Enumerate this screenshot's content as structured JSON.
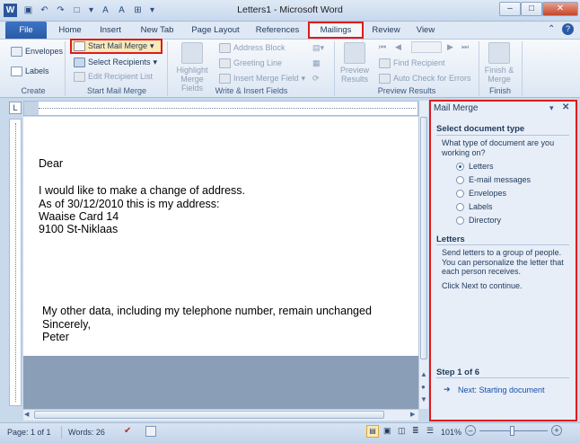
{
  "window": {
    "title": "Letters1 - Microsoft Word"
  },
  "tabs": [
    "File",
    "Home",
    "Insert",
    "New Tab",
    "Page Layout",
    "References",
    "Mailings",
    "Review",
    "View"
  ],
  "ribbon": {
    "create": {
      "label": "Create",
      "envelopes": "Envelopes",
      "labels": "Labels"
    },
    "start": {
      "label": "Start Mail Merge",
      "start_btn": "Start Mail Merge",
      "select_recipients": "Select Recipients",
      "edit_list": "Edit Recipient List"
    },
    "write": {
      "label": "Write & Insert Fields",
      "highlight_1": "Highlight",
      "highlight_2": "Merge Fields",
      "address_block": "Address Block",
      "greeting_line": "Greeting Line",
      "insert_merge_field": "Insert Merge Field"
    },
    "preview": {
      "label": "Preview Results",
      "preview_1": "Preview",
      "preview_2": "Results",
      "find_recipient": "Find Recipient",
      "auto_check": "Auto Check for Errors"
    },
    "finish": {
      "label": "Finish",
      "finish_1": "Finish &",
      "finish_2": "Merge"
    }
  },
  "document": {
    "lines_top": [
      "Dear",
      "",
      "I would like to make a change of address.",
      "As of 30/12/2010 this is my address:",
      "Waaise Card 14",
      "9100 St-Niklaas"
    ],
    "lines_bottom": [
      "My other data, including my telephone number, remain unchanged",
      "Sincerely,",
      "Peter"
    ]
  },
  "pane": {
    "title": "Mail Merge",
    "section1_header": "Select document type",
    "section1_question": "What type of document are you working on?",
    "options": [
      "Letters",
      "E-mail messages",
      "Envelopes",
      "Labels",
      "Directory"
    ],
    "selected_option": "Letters",
    "section2_header": "Letters",
    "section2_text": "Send letters to a group of people. You can personalize the letter that each person receives.",
    "section2_note": "Click Next to continue.",
    "step": "Step 1 of 6",
    "next_link": "Next: Starting document"
  },
  "status": {
    "page": "Page: 1 of 1",
    "words": "Words: 26",
    "zoom": "101%"
  },
  "colors": {
    "accent": "#2a5aa8",
    "highlight_border": "#e01b1b",
    "pane_bg": "#e7eef8"
  }
}
